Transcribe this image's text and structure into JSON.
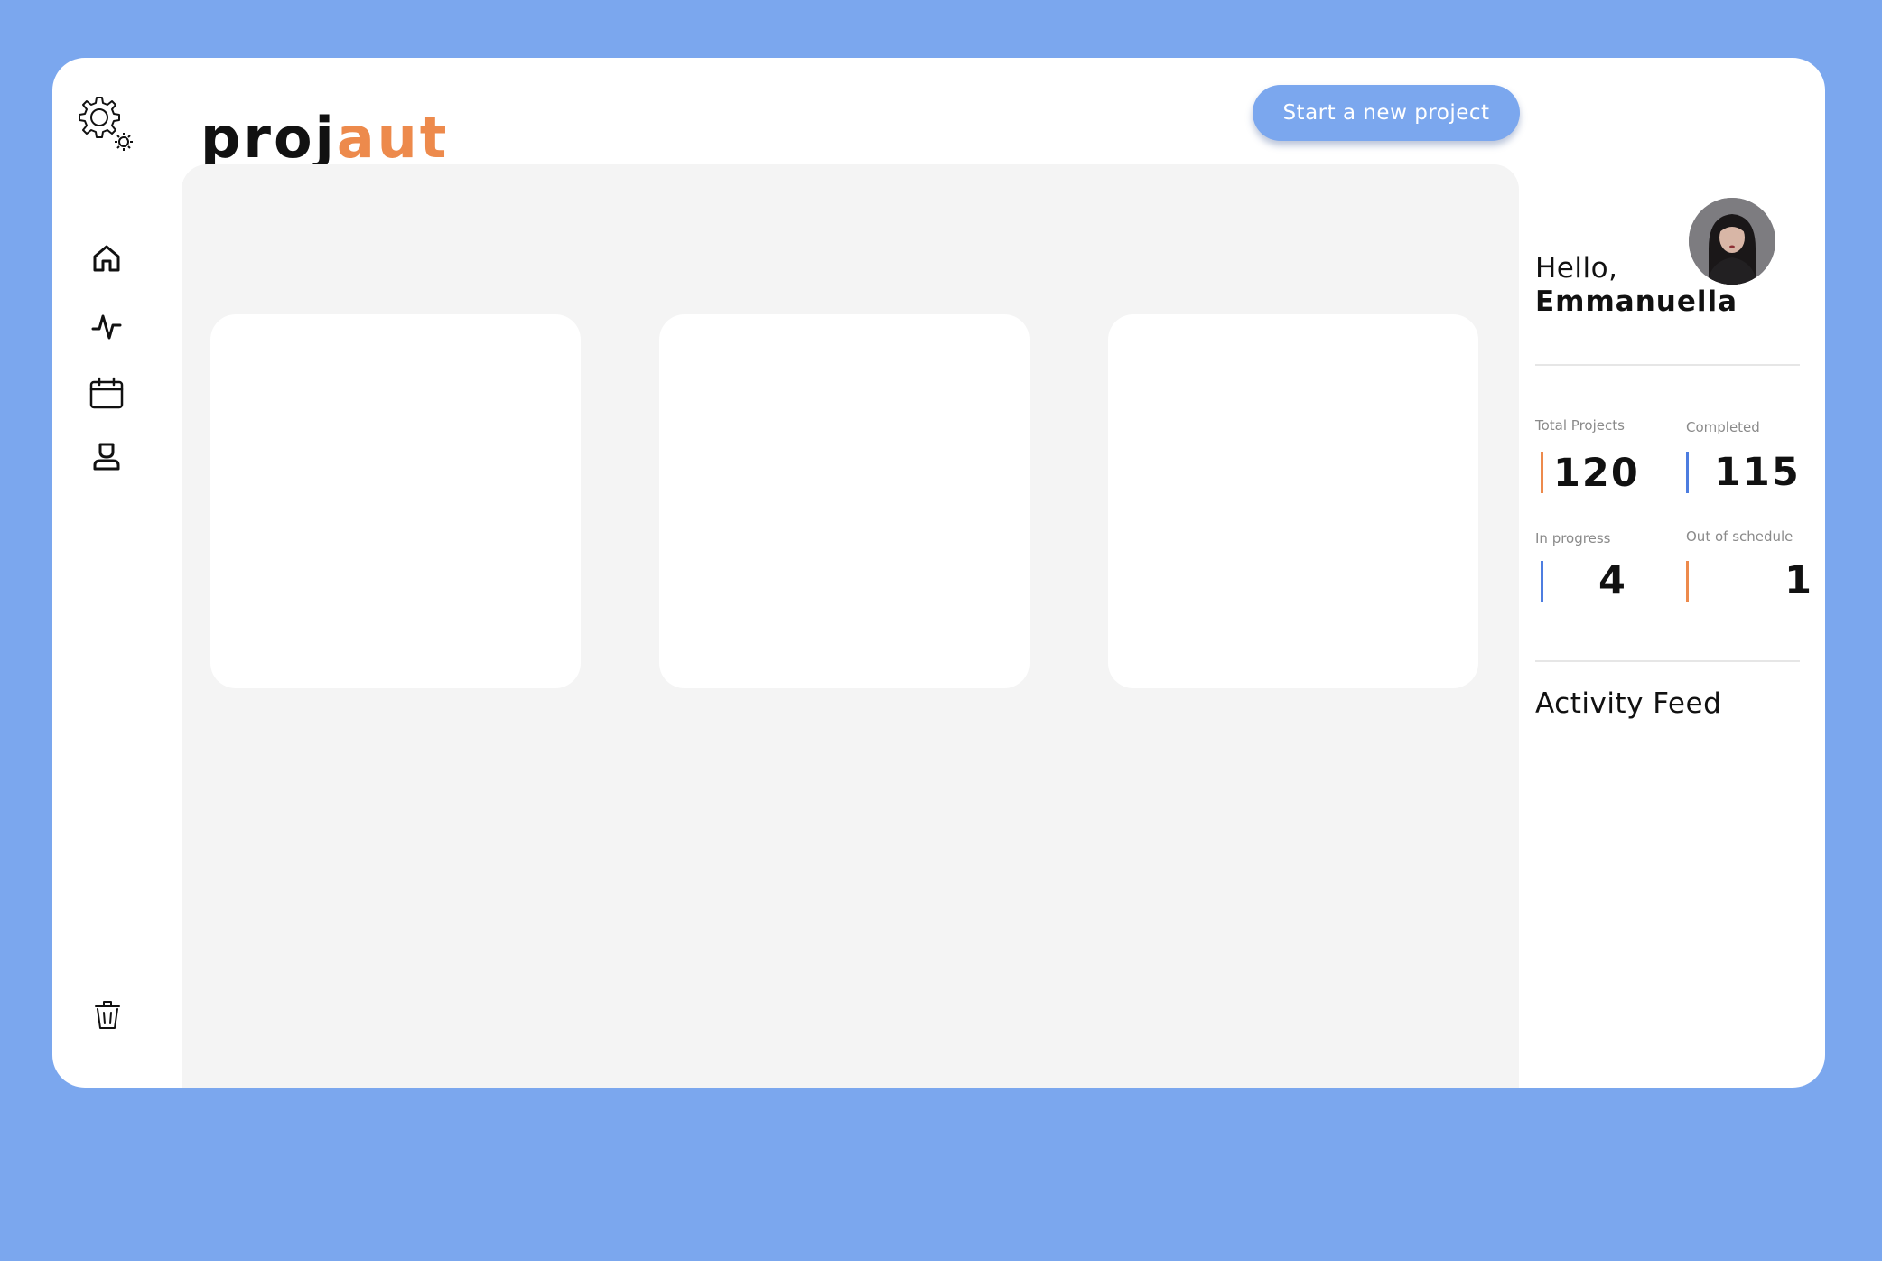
{
  "app": {
    "logo_part1": "proj",
    "logo_part2": "aut",
    "brand_color": "#ed8a4c",
    "accent_color": "#7ba7ee"
  },
  "sidebar": {
    "top_icon": "settings-gear-icon",
    "items": [
      {
        "name": "home",
        "icon": "home-icon"
      },
      {
        "name": "activity",
        "icon": "activity-pulse-icon"
      },
      {
        "name": "calendar",
        "icon": "calendar-icon"
      },
      {
        "name": "profile",
        "icon": "user-icon"
      }
    ],
    "bottom_icon": "trash-icon"
  },
  "header": {
    "new_project_label": "Start a new project"
  },
  "main": {
    "cards": [
      {},
      {},
      {}
    ]
  },
  "profile": {
    "greeting": "Hello,",
    "name": "Emmanuella"
  },
  "stats": {
    "total_projects": {
      "label": "Total Projects",
      "value": "120",
      "accent": "#ed8a4c"
    },
    "completed": {
      "label": "Completed",
      "value": "115",
      "accent": "#4d7de0"
    },
    "in_progress": {
      "label": "In progress",
      "value": "4",
      "accent": "#4d7de0"
    },
    "out_of_schedule": {
      "label": "Out of schedule",
      "value": "1",
      "accent": "#ed8a4c"
    }
  },
  "activity_feed": {
    "title": "Activity Feed"
  }
}
